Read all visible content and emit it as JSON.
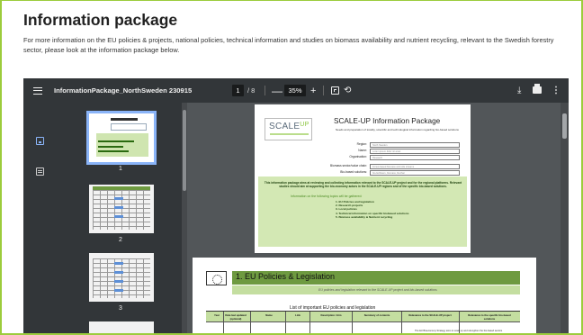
{
  "page": {
    "heading": "Information package",
    "intro": "For more information on the EU policies & projects, national policies, technical information and studies on biomass availability and nutrient recycling, relevant to the Swedish forestry sector, please look at the information package below.",
    "accent_color": "#9ccc3c"
  },
  "viewer": {
    "menu_icon": "hamburger-menu-icon",
    "doc_title": "InformationPackage_NorthSweden 230915",
    "current_page": "1",
    "page_total": "/ 8",
    "zoom_out": "—",
    "zoom_level": "35%",
    "zoom_in": "+",
    "fit_icon": "fit-to-page-icon",
    "rotate_icon": "rotate-icon",
    "rotate_glyph": "⟲",
    "download_icon": "download-icon",
    "download_glyph": "⤓",
    "print_icon": "print-icon",
    "more_icon": "more-vertical-icon",
    "more_glyph": "⋮"
  },
  "sidebar": {
    "thumbnails": [
      {
        "number": "1"
      },
      {
        "number": "2"
      },
      {
        "number": "3"
      }
    ]
  },
  "document": {
    "page1": {
      "logo": "SCALE",
      "logo_up": "UP",
      "title": "SCALE-UP Information Package",
      "subtitle": "Needs and preparation of locality, scientific and technological information regarding bio-based solutions",
      "fields": [
        {
          "label": "Region:",
          "value": "North Sweden"
        },
        {
          "label": "Name:",
          "value": "Lorem ipsum dolor sit amet"
        },
        {
          "label": "Organisation:",
          "value": "Research"
        },
        {
          "label": "Biomass sector/value chain:",
          "value": "Forest-based biomass and side streams"
        },
        {
          "label": "Bio-based solutions:",
          "value": "bio-fertilisers, biomass, biochar"
        }
      ],
      "intro": "This information package aims at reviewing and collecting information relevant to the SCALE-UP project and for the regional platforms. Relevant studies should aim at supporting the bio-economy actors in the SCALE-UP regions and of the specific bio-based solutions.",
      "covered": "Information on the following topics will be gathered:",
      "topics": [
        "1. EU Policies and legislation",
        "2. Research projects",
        "3. Local policies",
        "4. Technical information on specific biobased solutions",
        "5. Biomass availability & Nutrient recycling"
      ]
    },
    "page2": {
      "title": "1. EU Policies & Legislation",
      "bar_text": "EU policies and legislation relevant to the SCALE-UP project and bio-based solutions",
      "table_title": "List of important EU policies and legislation",
      "columns": [
        "Year",
        "Date last updated (optional)",
        "Name",
        "Link",
        "Description / Aim",
        "Summary of contents",
        "Relevance to the SCALE-UP project",
        "Relevance to the specific bio-based solutions"
      ],
      "note": "The EU Bioeconomy Strategy aims to scale up and strengthen the bio-based sectors"
    }
  }
}
